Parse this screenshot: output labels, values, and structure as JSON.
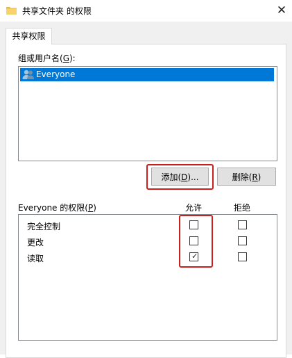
{
  "window": {
    "title": "共享文件夹 的权限",
    "close_label": "✕"
  },
  "tab": {
    "label": "共享权限"
  },
  "groups": {
    "label_main": "组或用户名(",
    "label_key": "G",
    "label_end": "):",
    "items": [
      {
        "name": "Everyone",
        "selected": true,
        "icon": "users-icon"
      }
    ]
  },
  "buttons": {
    "add": {
      "main": "添加(",
      "key": "D",
      "end": ")..."
    },
    "remove": {
      "main": "删除(",
      "key": "R",
      "end": ")"
    }
  },
  "permissions": {
    "label_main": "Everyone 的权限(",
    "label_key": "P",
    "label_end": ")",
    "allow_header": "允许",
    "deny_header": "拒绝",
    "rows": [
      {
        "name": "完全控制",
        "allow": false,
        "deny": false
      },
      {
        "name": "更改",
        "allow": false,
        "deny": false
      },
      {
        "name": "读取",
        "allow": true,
        "deny": false
      }
    ]
  },
  "colors": {
    "selection": "#0078d7",
    "highlight": "#c8201a",
    "button": "#e1e1e1"
  }
}
